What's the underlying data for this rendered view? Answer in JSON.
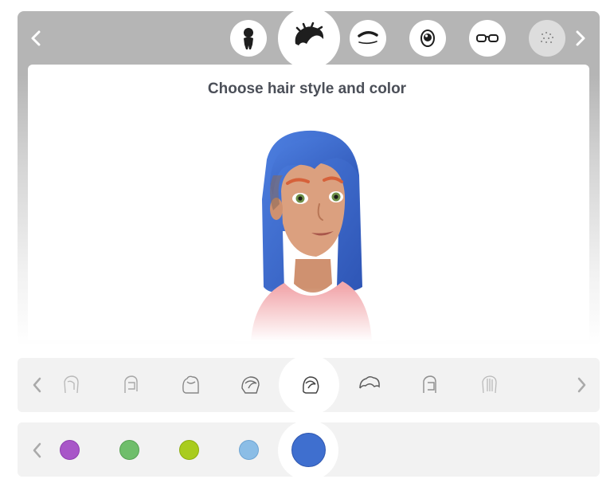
{
  "header": {
    "title": "Choose hair style and color",
    "prev_icon": "chevron-left-icon",
    "next_icon": "chevron-right-icon"
  },
  "categories": [
    {
      "id": "body-shape",
      "icon": "body-silhouette-icon",
      "selected": false
    },
    {
      "id": "hair",
      "icon": "hair-icon",
      "selected": true
    },
    {
      "id": "eyebrows",
      "icon": "eyebrow-icon",
      "selected": false
    },
    {
      "id": "eyes",
      "icon": "eye-icon",
      "selected": false
    },
    {
      "id": "glasses",
      "icon": "glasses-icon",
      "selected": false
    },
    {
      "id": "skin-details",
      "icon": "freckles-icon",
      "selected": false
    }
  ],
  "hair_styles": {
    "count_visible": 8,
    "selected_index": 4
  },
  "hair_colors": {
    "swatches": [
      "#a856c8",
      "#6fbe6b",
      "#a9cc1e",
      "#8bbde6",
      "#3f6fcf"
    ],
    "selected_index": 4
  },
  "colors": {
    "hair": "#3f6fcf",
    "skin": "#dba07f",
    "shirt": "#f2a9ad",
    "accent_text": "#4b4f58"
  }
}
